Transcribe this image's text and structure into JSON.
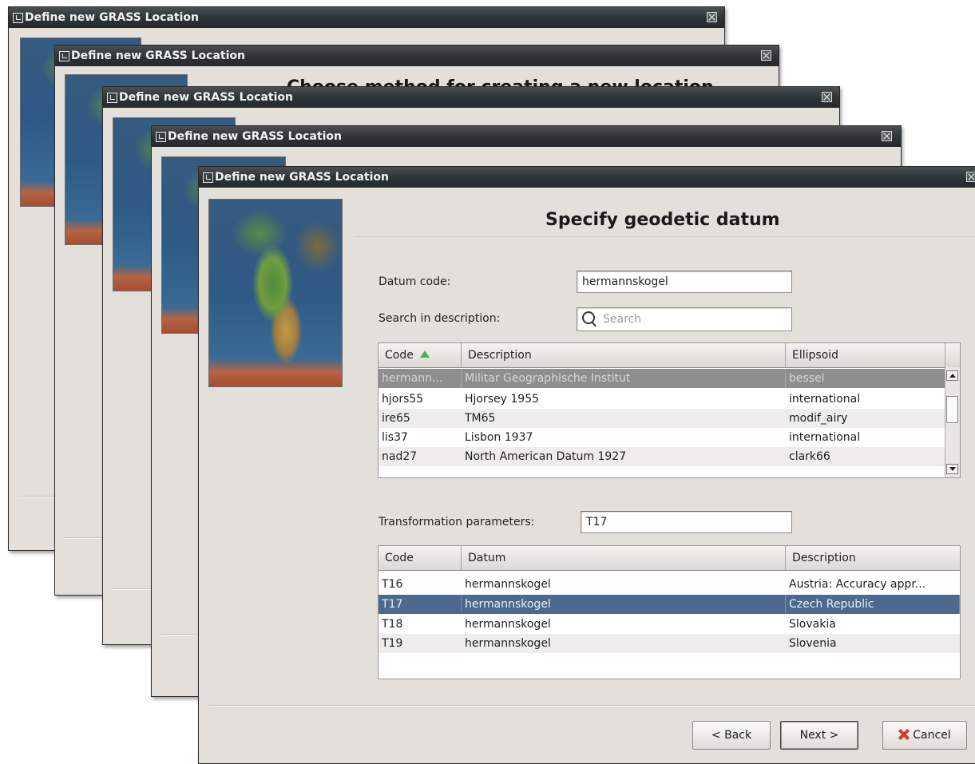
{
  "window_title": "Define new GRASS Location",
  "background_window_heading": "Choose method for creating a new location",
  "page_heading": "Specify geodetic datum",
  "datum_code": {
    "label": "Datum code:",
    "value": "hermannskogel"
  },
  "search": {
    "label": "Search in description:",
    "placeholder": "Search",
    "icon": "search-icon"
  },
  "datum_table": {
    "columns": [
      "Code",
      "Description",
      "Ellipsoid"
    ],
    "sort_indicator": "sort-arrow-up-icon",
    "rows": [
      {
        "code": "hermann...",
        "description": "Militar Geographische Institut",
        "ellipsoid": "bessel"
      },
      {
        "code": "hjors55",
        "description": "Hjorsey 1955",
        "ellipsoid": "international"
      },
      {
        "code": "ire65",
        "description": "TM65",
        "ellipsoid": "modif_airy"
      },
      {
        "code": "lis37",
        "description": "Lisbon 1937",
        "ellipsoid": "international"
      },
      {
        "code": "nad27",
        "description": "North American Datum 1927",
        "ellipsoid": "clark66"
      }
    ]
  },
  "transform": {
    "label": "Transformation parameters:",
    "value": "T17"
  },
  "transform_table": {
    "columns": [
      "Code",
      "Datum",
      "Description"
    ],
    "rows": [
      {
        "code": "T16",
        "datum": "hermannskogel",
        "description": "Austria: Accuracy appr..."
      },
      {
        "code": "T17",
        "datum": "hermannskogel",
        "description": "Czech Republic"
      },
      {
        "code": "T18",
        "datum": "hermannskogel",
        "description": "Slovakia"
      },
      {
        "code": "T19",
        "datum": "hermannskogel",
        "description": "Slovenia"
      }
    ]
  },
  "buttons": {
    "back": "< Back",
    "next": "Next >",
    "cancel": "Cancel"
  },
  "colors": {
    "titlebar": "#2f3335",
    "window_bg": "#e3e0dc",
    "selection_blue": "#4b6a8e",
    "selection_gray": "#8e8e8e"
  }
}
